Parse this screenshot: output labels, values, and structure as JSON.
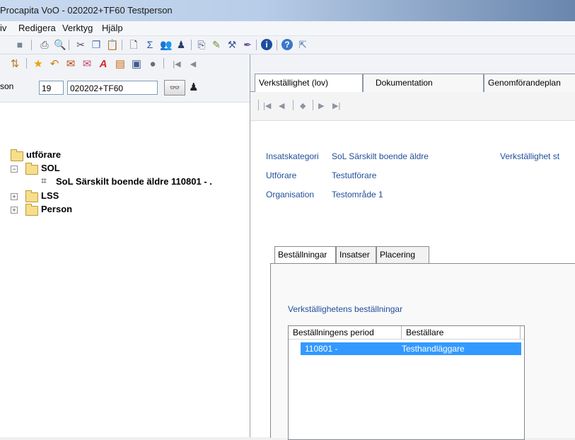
{
  "titlebar": {
    "title": "Procapita VoO - 020202+TF60 Testperson"
  },
  "menubar": {
    "items": [
      "iv",
      "Redigera",
      "Verktyg",
      "Hjälp"
    ]
  },
  "person": {
    "label": "son",
    "century": "19",
    "id": "020202+TF60"
  },
  "tree": {
    "root": "utförare",
    "items": [
      {
        "label": "SOL",
        "expanded": true
      },
      {
        "label": "SoL Särskilt boende äldre 110801 - ."
      },
      {
        "label": "LSS",
        "expanded": false
      },
      {
        "label": "Person",
        "expanded": false
      }
    ]
  },
  "tabs": [
    "Verkställighet (lov)",
    "Dokumentation",
    "Genomförandeplan"
  ],
  "details": {
    "insatskategori_label": "Insatskategori",
    "insatskategori_value": "SoL Särskilt boende äldre",
    "status_label": "Verkställighet st",
    "utforare_label": "Utförare",
    "utforare_value": "Testutförare",
    "organisation_label": "Organisation",
    "organisation_value": "Testområde 1"
  },
  "subtabs": [
    "Beställningar",
    "Insatser",
    "Placering"
  ],
  "orders": {
    "heading": "Verkställighetens beställningar",
    "columns": [
      "Beställningens period",
      "Beställare"
    ],
    "rows": [
      {
        "period": "110801 -",
        "bestallare": "Testhandläggare"
      }
    ]
  },
  "colors": {
    "selection": "#3399ff",
    "label_blue": "#1f4e9a"
  }
}
